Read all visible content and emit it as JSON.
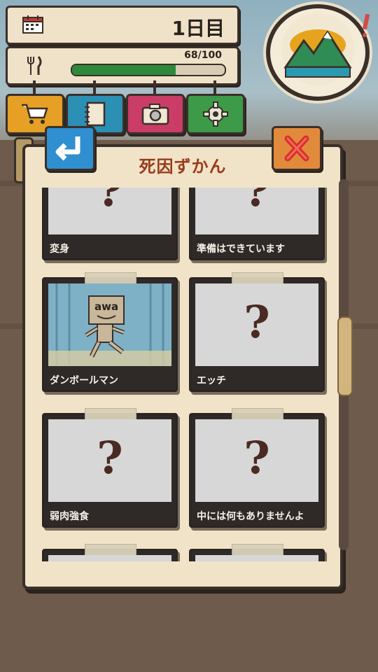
{
  "status": {
    "day_label": "1日目",
    "hunger_text": "68/100",
    "hunger_value": 68,
    "hunger_max": 100
  },
  "menu": [
    {
      "icon": "cart-icon",
      "color": "#e5a025"
    },
    {
      "icon": "notebook-icon",
      "color": "#2c8fb4"
    },
    {
      "icon": "camera-icon",
      "color": "#c93d66"
    },
    {
      "icon": "gear-icon",
      "color": "#3c9a49"
    }
  ],
  "panel": {
    "title": "死因ずかん"
  },
  "entries": [
    {
      "label": "変身",
      "unlocked": false
    },
    {
      "label": "準備はできています",
      "unlocked": false
    },
    {
      "label": "ダンボールマン",
      "unlocked": true,
      "box_text": "awa"
    },
    {
      "label": "エッチ",
      "unlocked": false
    },
    {
      "label": "弱肉強食",
      "unlocked": false
    },
    {
      "label": "中には何もありませんよ",
      "unlocked": false
    },
    {
      "label": "",
      "unlocked": false
    },
    {
      "label": "",
      "unlocked": false
    }
  ],
  "colors": {
    "title": "#9a3b1d",
    "hunger_fill": "#2e8a3a",
    "back_button": "#2f8fd0",
    "close_button": "#e28a3b"
  }
}
